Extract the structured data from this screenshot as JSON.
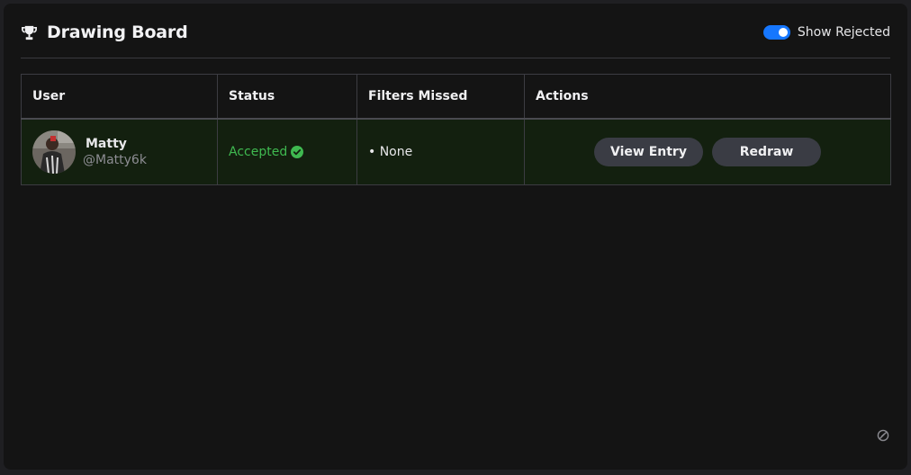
{
  "header": {
    "title": "Drawing Board",
    "title_icon": "trophy-icon",
    "toggle_label": "Show Rejected",
    "toggle_on": true,
    "toggle_color": "#1677ff"
  },
  "table": {
    "columns": [
      "User",
      "Status",
      "Filters Missed",
      "Actions"
    ],
    "rows": [
      {
        "user_name": "Matty",
        "user_handle": "@Matty6k",
        "status": "Accepted",
        "status_icon": "check-circle-icon",
        "status_color": "#3fb950",
        "filters_missed": "• None",
        "actions": [
          "View Entry",
          "Redraw"
        ]
      }
    ]
  },
  "footer": {
    "corner_icon": "disabled-circle-icon"
  }
}
